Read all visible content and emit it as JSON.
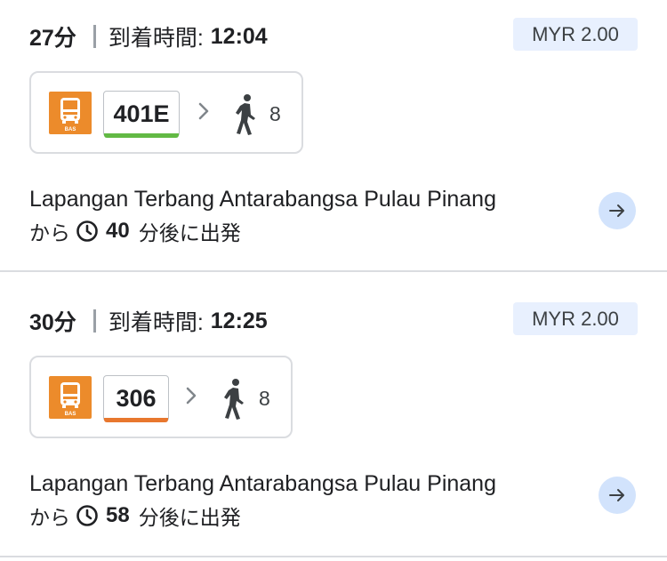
{
  "routes": [
    {
      "duration": "27分",
      "arrival_label": "到着時間:",
      "arrival_time": "12:04",
      "fare": "MYR 2.00",
      "bus_icon_label": "BAS",
      "route_number": "401E",
      "route_color": "#62b944",
      "walk_minutes": "8",
      "stop_name": "Lapangan Terbang Antarabangsa Pulau Pinang",
      "from_label": "から",
      "depart_minutes": "40",
      "depart_suffix": "分後に出発"
    },
    {
      "duration": "30分",
      "arrival_label": "到着時間:",
      "arrival_time": "12:25",
      "fare": "MYR 2.00",
      "bus_icon_label": "BAS",
      "route_number": "306",
      "route_color": "#e8772e",
      "walk_minutes": "8",
      "stop_name": "Lapangan Terbang Antarabangsa Pulau Pinang",
      "from_label": "から",
      "depart_minutes": "58",
      "depart_suffix": "分後に出発"
    }
  ],
  "colors": {
    "bus_icon_bg": "#ec8b2b",
    "fare_bg": "#e8f0fe",
    "go_button_bg": "#d2e3fc"
  },
  "icons": [
    "bus-icon",
    "chevron-right-icon",
    "walk-icon",
    "clock-icon",
    "arrow-right-icon"
  ]
}
